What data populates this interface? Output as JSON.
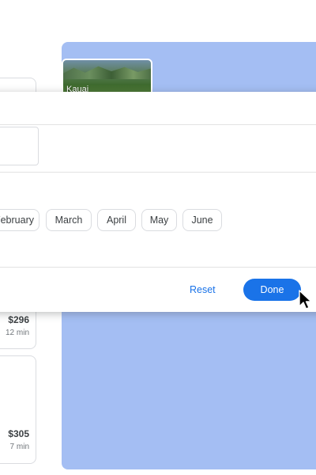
{
  "map": {
    "destination_label": "Kauai"
  },
  "popup": {
    "months": [
      "February",
      "March",
      "April",
      "May",
      "June"
    ],
    "reset_label": "Reset",
    "done_label": "Done"
  },
  "results": [
    {
      "price": "$296",
      "duration": "12 min"
    },
    {
      "price": "$305",
      "duration": "7 min"
    }
  ],
  "colors": {
    "accent": "#1a73e8",
    "map": "#a4bef3"
  }
}
